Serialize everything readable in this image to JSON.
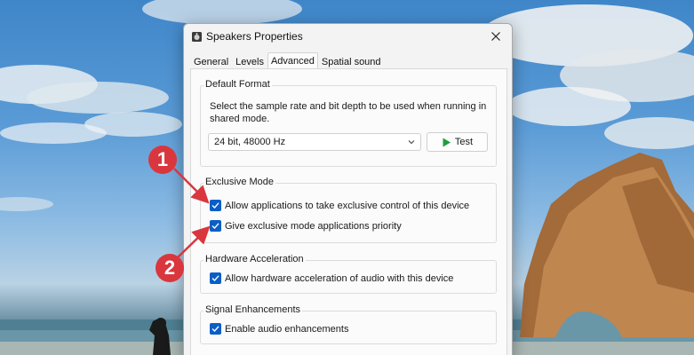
{
  "window": {
    "title": "Speakers Properties"
  },
  "tabs": [
    {
      "label": "General",
      "active": false
    },
    {
      "label": "Levels",
      "active": false
    },
    {
      "label": "Advanced",
      "active": true
    },
    {
      "label": "Spatial sound",
      "active": false
    }
  ],
  "default_format": {
    "group_label": "Default Format",
    "description": "Select the sample rate and bit depth to be used when running in shared mode.",
    "selected_format": "24 bit, 48000 Hz",
    "test_label": "Test"
  },
  "exclusive_mode": {
    "group_label": "Exclusive Mode",
    "allow_exclusive_label": "Allow applications to take exclusive control of this device",
    "allow_exclusive_checked": true,
    "priority_label": "Give exclusive mode applications priority",
    "priority_checked": true
  },
  "hardware_acceleration": {
    "group_label": "Hardware Acceleration",
    "allow_hw_label": "Allow hardware acceleration of audio with this device",
    "allow_hw_checked": true
  },
  "signal_enhancements": {
    "group_label": "Signal Enhancements",
    "enable_label": "Enable audio enhancements",
    "enable_checked": true
  },
  "annotations": {
    "step1": "1",
    "step2": "2"
  },
  "colors": {
    "accent": "#0a5ec8",
    "annotation": "#d9363e",
    "test_play": "#1e9e3e"
  },
  "icons": {
    "title": "speaker-icon",
    "close": "close-icon",
    "dropdown": "chevron-down-icon",
    "test": "play-icon",
    "check": "checkmark-icon"
  }
}
